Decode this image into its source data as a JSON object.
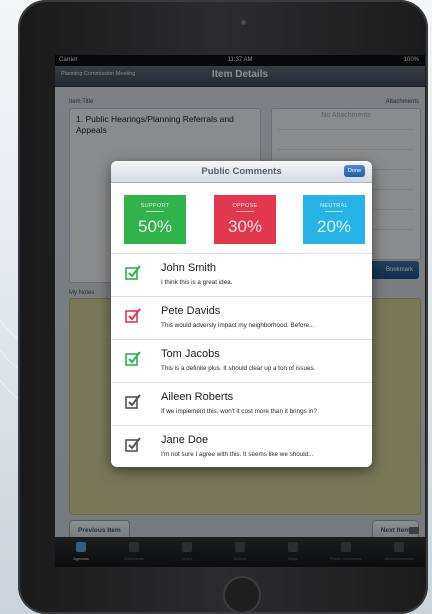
{
  "status_bar": {
    "carrier": "Carrier",
    "time": "11:37 AM",
    "battery": "100%"
  },
  "nav": {
    "back_label": "Planning Commission Meeting",
    "title": "Item Details"
  },
  "item": {
    "title_label": "Item Title",
    "title_value": "1. Public Hearings/Planning Referrals and Appeals",
    "attachments_label": "Attachments",
    "attachments_empty": "No Attachments",
    "bookmark_label": "Bookmark",
    "notes_label": "My Notes"
  },
  "buttons": {
    "previous": "Previous Item",
    "next": "Next Item"
  },
  "tabs": [
    {
      "label": "Agendas",
      "active": true
    },
    {
      "label": "Documents",
      "active": false
    },
    {
      "label": "Notes",
      "active": false
    },
    {
      "label": "Videos",
      "active": false
    },
    {
      "label": "Maps",
      "active": false
    },
    {
      "label": "Public Comments",
      "active": false
    },
    {
      "label": "Announcements",
      "active": false
    }
  ],
  "popup": {
    "title": "Public Comments",
    "done_label": "Done",
    "stats": [
      {
        "label": "SUPPORT",
        "value": "50%",
        "color": "#2fb34a"
      },
      {
        "label": "OPPOSE",
        "value": "30%",
        "color": "#e2384e"
      },
      {
        "label": "NEUTRAL",
        "value": "20%",
        "color": "#27b3e6"
      }
    ],
    "comments": [
      {
        "name": "John Smith",
        "text": "I think this is a great idea.",
        "stance_color": "#2fb34a",
        "icon": "check-box-icon"
      },
      {
        "name": "Pete Davids",
        "text": "This would adversly impact my neighborhood. Before...",
        "stance_color": "#e2384e",
        "icon": "check-box-icon"
      },
      {
        "name": "Tom Jacobs",
        "text": "This is a definite plus. It should clear up a ton of issues.",
        "stance_color": "#2fb34a",
        "icon": "check-box-icon"
      },
      {
        "name": "Aileen Roberts",
        "text": "If we implement this, won't it cost more than it brings in?",
        "stance_color": "#555555",
        "icon": "check-box-icon"
      },
      {
        "name": "Jane Doe",
        "text": "I'm not sure I agree with this. It seems like we should...",
        "stance_color": "#555555",
        "icon": "check-box-icon"
      }
    ]
  }
}
